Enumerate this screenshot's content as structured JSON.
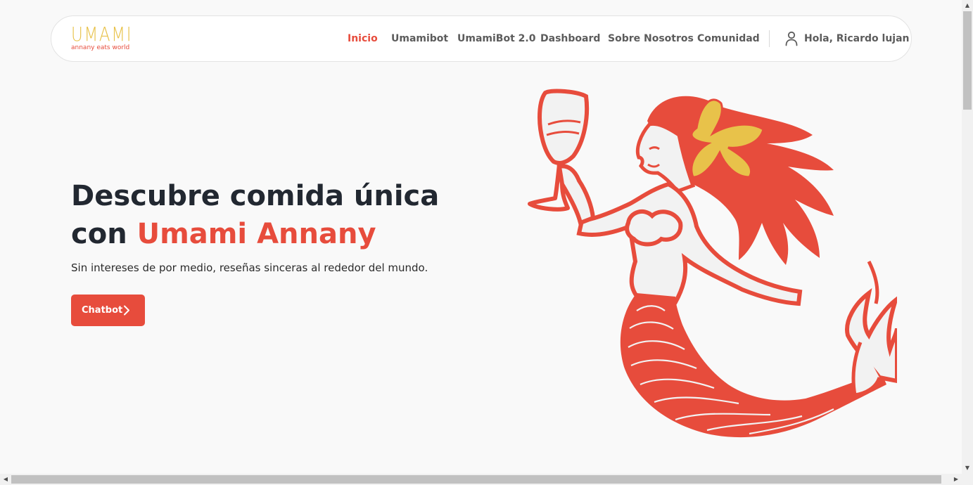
{
  "brand": {
    "logo_text": "UMAMI",
    "tagline": "annany eats world",
    "accent_color": "#e74c3c",
    "logo_color": "#e8c24a"
  },
  "nav": {
    "items": [
      {
        "label": "Inicio",
        "active": true
      },
      {
        "label": "Umamibot"
      },
      {
        "label": "UmamiBot 2.0"
      },
      {
        "label": "Dashboard"
      },
      {
        "label": "Sobre Nosotros"
      },
      {
        "label": "Comunidad"
      }
    ],
    "user_greeting": "Hola, Ricardo lujan",
    "user_icon": "user-icon"
  },
  "hero": {
    "title_line1": "Descubre comida única",
    "title_line2_prefix": "con ",
    "title_accent": "Umami Annany",
    "subtitle": "Sin intereses de por medio, reseñas sinceras al rededor del mundo.",
    "cta_label": "Chatbot",
    "cta_icon": "chevron-right-icon",
    "illustration": "mermaid-with-wine-glass"
  }
}
